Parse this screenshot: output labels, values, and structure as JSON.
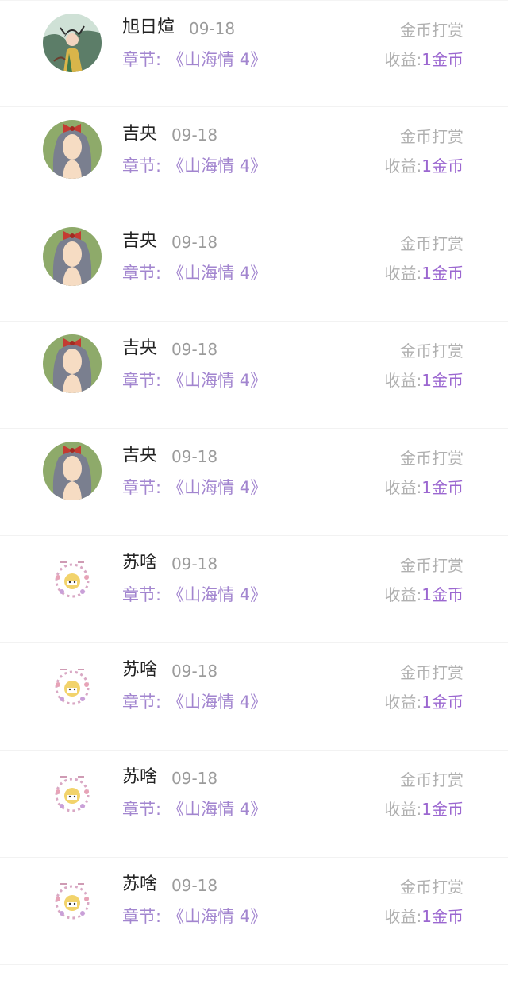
{
  "records": [
    {
      "name": "旭日煊",
      "date": "09-18",
      "chapter_label": "章节:",
      "chapter": "《山海情 4》",
      "type": "金币打赏",
      "income_label": "收益:",
      "income": "1金币",
      "avatar": "painted-woman-avatar"
    },
    {
      "name": "吉央",
      "date": "09-18",
      "chapter_label": "章节:",
      "chapter": "《山海情 4》",
      "type": "金币打赏",
      "income_label": "收益:",
      "income": "1金币",
      "avatar": "girl-with-bow-avatar"
    },
    {
      "name": "吉央",
      "date": "09-18",
      "chapter_label": "章节:",
      "chapter": "《山海情 4》",
      "type": "金币打赏",
      "income_label": "收益:",
      "income": "1金币",
      "avatar": "girl-with-bow-avatar"
    },
    {
      "name": "吉央",
      "date": "09-18",
      "chapter_label": "章节:",
      "chapter": "《山海情 4》",
      "type": "金币打赏",
      "income_label": "收益:",
      "income": "1金币",
      "avatar": "girl-with-bow-avatar"
    },
    {
      "name": "吉央",
      "date": "09-18",
      "chapter_label": "章节:",
      "chapter": "《山海情 4》",
      "type": "金币打赏",
      "income_label": "收益:",
      "income": "1金币",
      "avatar": "girl-with-bow-avatar"
    },
    {
      "name": "苏啥",
      "date": "09-18",
      "chapter_label": "章节:",
      "chapter": "《山海情 4》",
      "type": "金币打赏",
      "income_label": "收益:",
      "income": "1金币",
      "avatar": "flower-wreath-avatar"
    },
    {
      "name": "苏啥",
      "date": "09-18",
      "chapter_label": "章节:",
      "chapter": "《山海情 4》",
      "type": "金币打赏",
      "income_label": "收益:",
      "income": "1金币",
      "avatar": "flower-wreath-avatar"
    },
    {
      "name": "苏啥",
      "date": "09-18",
      "chapter_label": "章节:",
      "chapter": "《山海情 4》",
      "type": "金币打赏",
      "income_label": "收益:",
      "income": "1金币",
      "avatar": "flower-wreath-avatar"
    },
    {
      "name": "苏啥",
      "date": "09-18",
      "chapter_label": "章节:",
      "chapter": "《山海情 4》",
      "type": "金币打赏",
      "income_label": "收益:",
      "income": "1金币",
      "avatar": "flower-wreath-avatar"
    }
  ]
}
